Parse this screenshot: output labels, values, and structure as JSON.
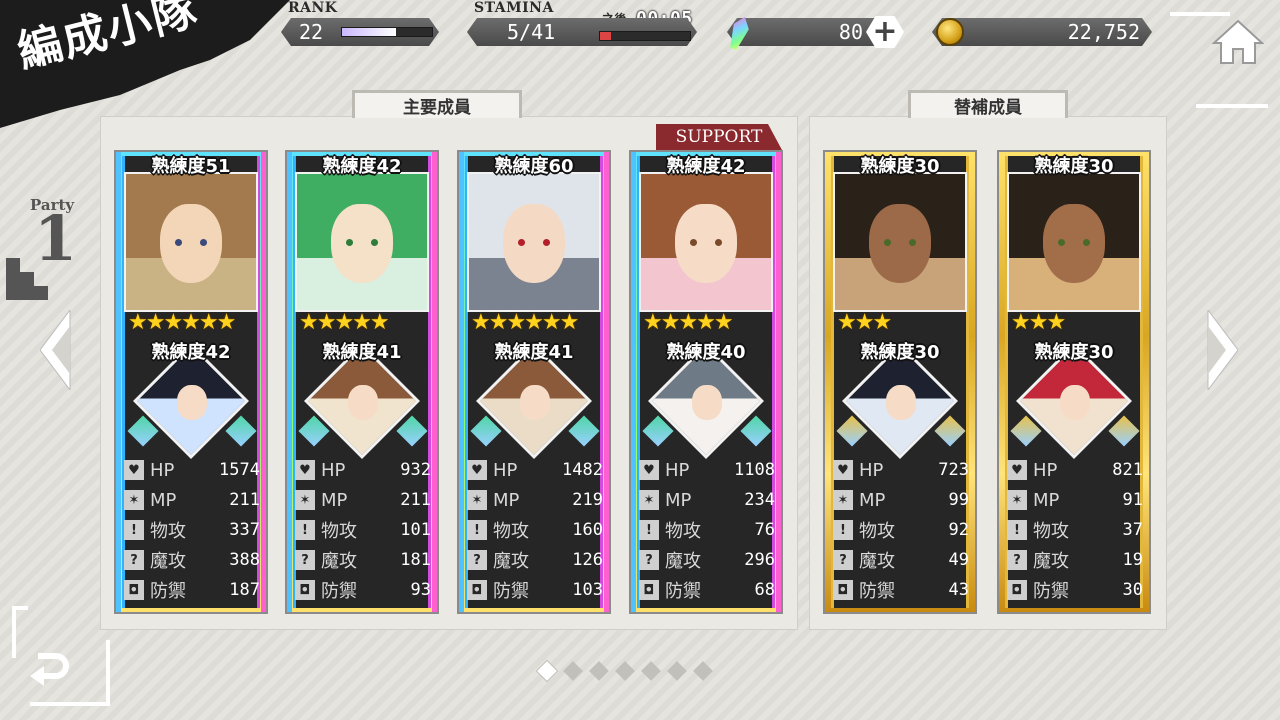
{
  "title": "編成小隊",
  "hud": {
    "rank_label": "RANK",
    "rank_value": "22",
    "rank_progress": 0.6,
    "stamina_label": "STAMINA",
    "stamina_value": "5/41",
    "stamina_progress": 0.12,
    "timer_prefix": "之後",
    "timer_value": "00:05",
    "crystals": "80",
    "gold": "22,752"
  },
  "party": {
    "label": "Party",
    "number": "1"
  },
  "main_tab": "主要成員",
  "sub_tab": "替補成員",
  "support_label": "SUPPORT",
  "stat_labels": {
    "hp": "HP",
    "mp": "MP",
    "atk": "物攻",
    "matk": "魔攻",
    "def": "防禦"
  },
  "cards": [
    {
      "frame": "rainbow",
      "main_prof": "熟練度51",
      "stars": "★★★★★★",
      "sub_prof": "熟練度42",
      "colors": {
        "hair": "#a27a4e",
        "skin": "#f3d6b8",
        "eye": "#3a4a7a",
        "bg": "#c9b384",
        "sub_hair": "#1e2230",
        "sub_bg": "#cfe3ff"
      },
      "stats": {
        "hp": "1574",
        "mp": "211",
        "atk": "337",
        "matk": "388",
        "def": "187"
      }
    },
    {
      "frame": "rainbow",
      "main_prof": "熟練度42",
      "stars": "★★★★★",
      "sub_prof": "熟練度41",
      "colors": {
        "hair": "#3fae62",
        "skin": "#f5e0c8",
        "eye": "#2e7d3a",
        "bg": "#d9efe0",
        "sub_hair": "#8a5a3a",
        "sub_bg": "#f1e4cf"
      },
      "stats": {
        "hp": "932",
        "mp": "211",
        "atk": "101",
        "matk": "181",
        "def": "93"
      }
    },
    {
      "frame": "rainbow",
      "main_prof": "熟練度60",
      "stars": "★★★★★★",
      "sub_prof": "熟練度41",
      "colors": {
        "hair": "#dfe4ea",
        "skin": "#f4dac4",
        "eye": "#b3202a",
        "bg": "#7b8390",
        "sub_hair": "#8a5a3a",
        "sub_bg": "#eadcc6"
      },
      "stats": {
        "hp": "1482",
        "mp": "219",
        "atk": "160",
        "matk": "126",
        "def": "103"
      }
    },
    {
      "frame": "rainbow",
      "main_prof": "熟練度42",
      "stars": "★★★★★",
      "sub_prof": "熟練度40",
      "colors": {
        "hair": "#9a5a36",
        "skin": "#f6dcc6",
        "eye": "#7a4a2a",
        "bg": "#f3c6cf",
        "sub_hair": "#6e7a86",
        "sub_bg": "#f4f1ee"
      },
      "stats": {
        "hp": "1108",
        "mp": "234",
        "atk": "76",
        "matk": "296",
        "def": "68"
      }
    },
    {
      "frame": "gold",
      "main_prof": "熟練度30",
      "stars": "★★★",
      "sub_prof": "熟練度30",
      "colors": {
        "hair": "#2a2118",
        "skin": "#9c6a48",
        "eye": "#4a6a2a",
        "bg": "#c8a37a",
        "sub_hair": "#1e2230",
        "sub_bg": "#dfe8f3"
      },
      "stats": {
        "hp": "723",
        "mp": "99",
        "atk": "92",
        "matk": "49",
        "def": "43"
      }
    },
    {
      "frame": "gold",
      "main_prof": "熟練度30",
      "stars": "★★★",
      "sub_prof": "熟練度30",
      "colors": {
        "hair": "#2a2118",
        "skin": "#a26e4a",
        "eye": "#4a6a2a",
        "bg": "#d8b07a",
        "sub_hair": "#c2283a",
        "sub_bg": "#f1e2cf"
      },
      "stats": {
        "hp": "821",
        "mp": "91",
        "atk": "37",
        "matk": "19",
        "def": "30"
      }
    }
  ],
  "page_dots": 7,
  "active_dot": 0,
  "icons": {
    "home": "home-icon",
    "back": "return-icon",
    "crystal": "crystal-icon",
    "coin": "coin-icon",
    "plus": "plus-icon"
  }
}
